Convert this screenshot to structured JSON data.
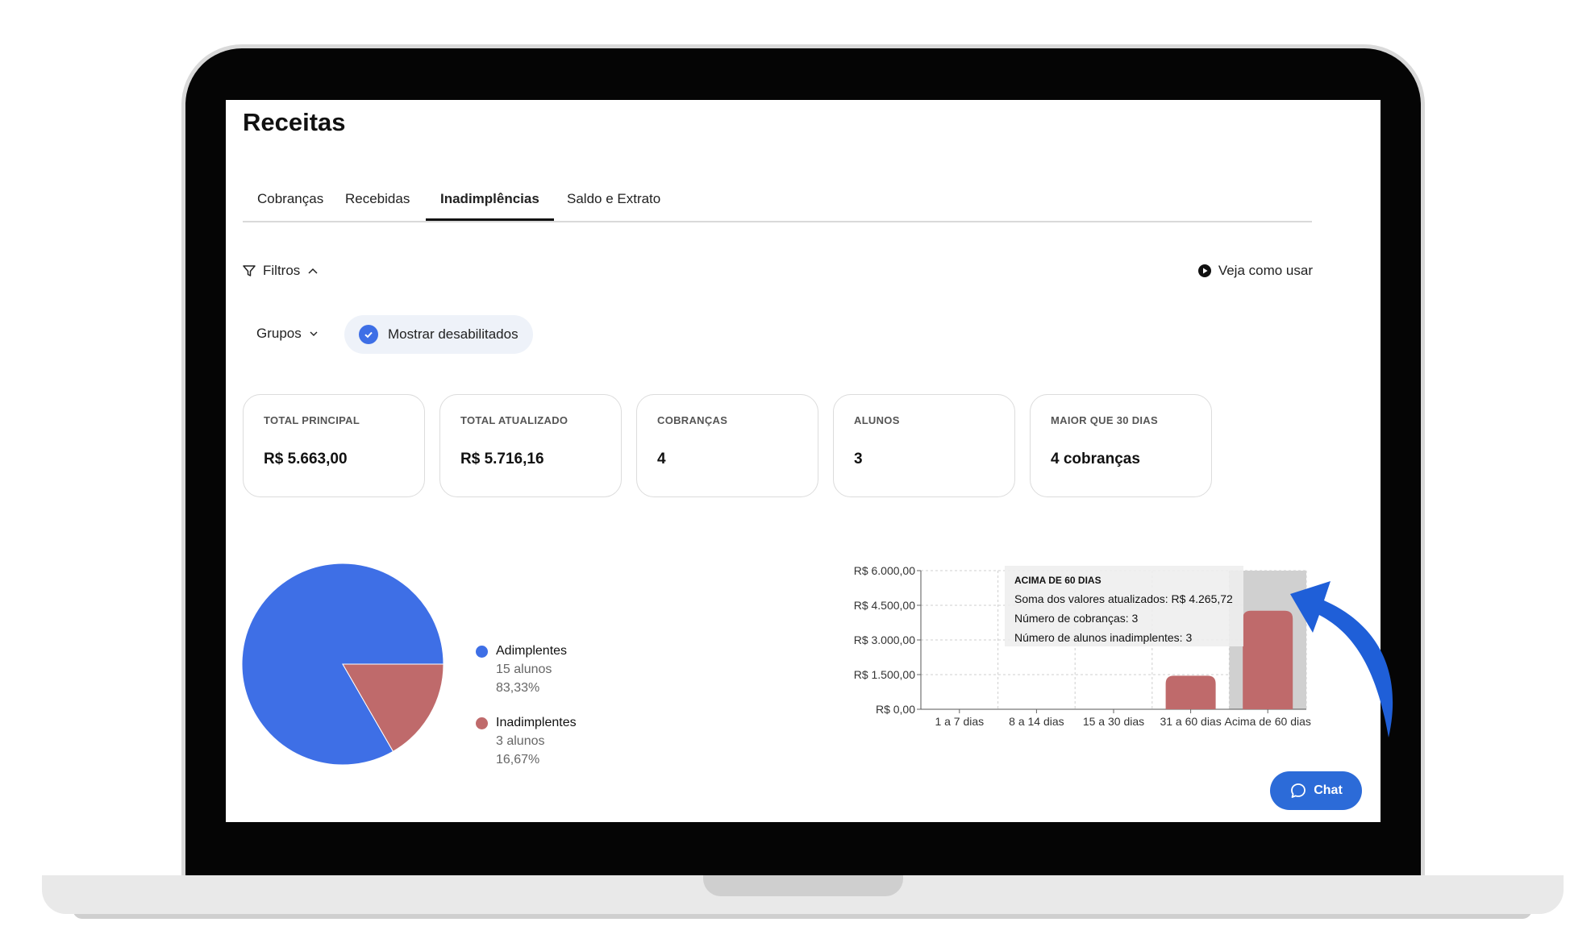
{
  "page": {
    "title": "Receitas"
  },
  "tabs": [
    {
      "label": "Cobranças",
      "active": false
    },
    {
      "label": "Recebidas",
      "active": false
    },
    {
      "label": "Inadimplências",
      "active": true
    },
    {
      "label": "Saldo e Extrato",
      "active": false
    }
  ],
  "filters": {
    "label": "Filtros",
    "help_label": "Veja como usar",
    "groups_label": "Grupos",
    "show_disabled_label": "Mostrar desabilitados",
    "show_disabled_checked": true
  },
  "cards": [
    {
      "label": "TOTAL PRINCIPAL",
      "value": "R$ 5.663,00"
    },
    {
      "label": "TOTAL ATUALIZADO",
      "value": "R$ 5.716,16"
    },
    {
      "label": "COBRANÇAS",
      "value": "4"
    },
    {
      "label": "ALUNOS",
      "value": "3"
    },
    {
      "label": "MAIOR QUE 30 DIAS",
      "value": "4 cobranças"
    }
  ],
  "pie": {
    "legend": [
      {
        "name": "Adimplentes",
        "count": "15 alunos",
        "percent": "83,33%",
        "color": "#3e6fe6"
      },
      {
        "name": "Inadimplentes",
        "count": "3 alunos",
        "percent": "16,67%",
        "color": "#bf6a6b"
      }
    ]
  },
  "chart_data": [
    {
      "type": "pie",
      "categories": [
        "Adimplentes",
        "Inadimplentes"
      ],
      "values": [
        83.33,
        16.67
      ],
      "colors": [
        "#3e6fe6",
        "#bf6a6b"
      ]
    },
    {
      "type": "bar",
      "categories": [
        "1 a 7 dias",
        "8 a 14 dias",
        "15 a 30 dias",
        "31 a 60 dias",
        "Acima de 60 dias"
      ],
      "values": [
        0,
        0,
        0,
        1450.44,
        4265.72
      ],
      "ylim": [
        0,
        6000
      ],
      "yticks": [
        0,
        1500,
        3000,
        4500,
        6000
      ],
      "ytick_labels": [
        "R$ 0,00",
        "R$ 1.500,00",
        "R$ 3.000,00",
        "R$ 4.500,00",
        "R$ 6.000,00"
      ],
      "grid": true,
      "bar_color": "#bf6a6b",
      "highlighted_category": "Acima de 60 dias"
    }
  ],
  "tooltip": {
    "title": "ACIMA DE 60 DIAS",
    "line1": "Soma dos valores atualizados: R$ 4.265,72",
    "line2": "Número de cobranças: 3",
    "line3": "Número de alunos inadimplentes: 3"
  },
  "chat": {
    "label": "Chat"
  }
}
